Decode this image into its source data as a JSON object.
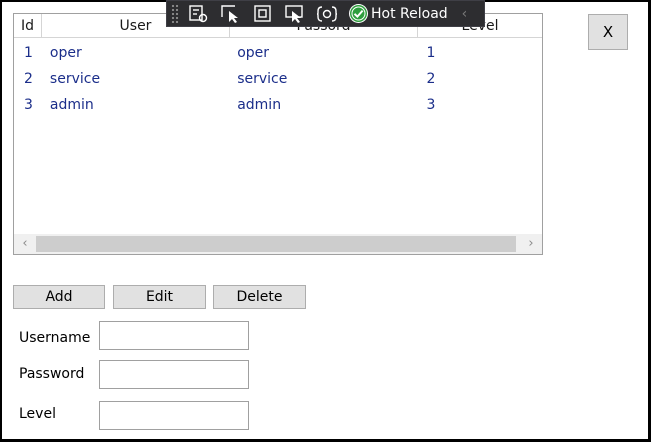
{
  "grid": {
    "columns": [
      "Id",
      "User",
      "Passord",
      "Level"
    ],
    "rows": [
      {
        "id": "1",
        "user": "oper",
        "password": "oper",
        "level": "1"
      },
      {
        "id": "2",
        "user": "service",
        "password": "service",
        "level": "2"
      },
      {
        "id": "3",
        "user": "admin",
        "password": "admin",
        "level": "3"
      }
    ],
    "scroll_left_icon": "chevron-left-icon",
    "scroll_right_icon": "chevron-right-icon"
  },
  "toolbar": {
    "hot_reload_label": "Hot Reload",
    "icons": [
      "live-visual-tree-icon",
      "select-element-icon",
      "display-layout-adorners-icon",
      "track-focused-element-icon",
      "binding-failures-icon",
      "hot-reload-status-icon",
      "collapse-chevron-icon"
    ]
  },
  "close_button": {
    "label": "X"
  },
  "actions": {
    "add": "Add",
    "edit": "Edit",
    "delete": "Delete"
  },
  "form": {
    "username_label": "Username",
    "password_label": "Password",
    "level_label": "Level",
    "username_value": "",
    "password_value": "",
    "level_value": ""
  },
  "colors": {
    "row_text": "#1b2e8a",
    "toolbar_bg": "#2d2d30",
    "check_green": "#2e9e3e"
  }
}
